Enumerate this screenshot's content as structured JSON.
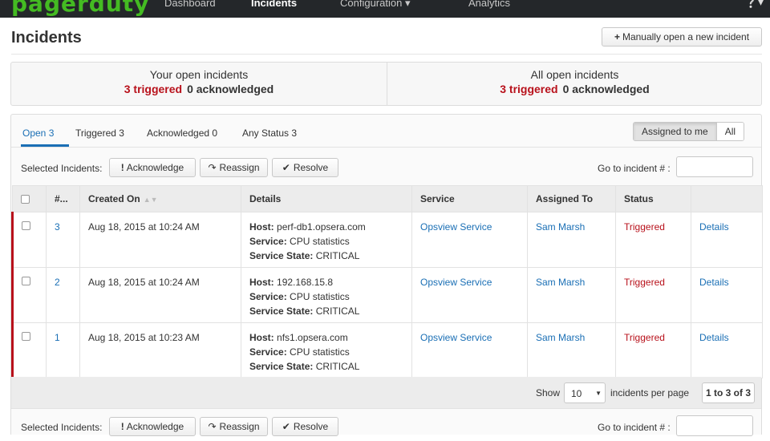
{
  "nav": {
    "logo": "pagerduty",
    "items": [
      {
        "label": "Dashboard",
        "active": false
      },
      {
        "label": "Incidents",
        "active": true
      },
      {
        "label": "Configuration ▾",
        "active": false
      },
      {
        "label": "Analytics",
        "active": false
      }
    ],
    "help_icon": "question-circle-icon"
  },
  "header": {
    "title": "Incidents",
    "new_incident_label": "Manually open a new incident"
  },
  "summary": {
    "yours": {
      "label": "Your open incidents",
      "triggered": "3 triggered",
      "acknowledged": "0 acknowledged"
    },
    "all": {
      "label": "All open incidents",
      "triggered": "3 triggered",
      "acknowledged": "0 acknowledged"
    }
  },
  "tabs": [
    {
      "label": "Open 3",
      "active": true
    },
    {
      "label": "Triggered 3",
      "active": false
    },
    {
      "label": "Acknowledged 0",
      "active": false
    },
    {
      "label": "Any Status 3",
      "active": false
    }
  ],
  "assignment_toggle": {
    "assigned_to_me": "Assigned to me",
    "all": "All"
  },
  "actions": {
    "selected_label": "Selected Incidents:",
    "acknowledge": "Acknowledge",
    "reassign": "Reassign",
    "resolve": "Resolve",
    "goto_label": "Go to incident # :"
  },
  "table": {
    "headers": [
      "#...",
      "Created On",
      "Details",
      "Service",
      "Assigned To",
      "Status"
    ],
    "detail_labels": {
      "host": "Host:",
      "service": "Service:",
      "state": "Service State:"
    },
    "rows": [
      {
        "num": "3",
        "created": "Aug 18, 2015 at 10:24 AM",
        "host": "perf-db1.opsera.com",
        "service_detail": "CPU statistics",
        "state": "CRITICAL",
        "service": "Opsview Service",
        "assigned": "Sam Marsh",
        "status": "Triggered",
        "link": "Details"
      },
      {
        "num": "2",
        "created": "Aug 18, 2015 at 10:24 AM",
        "host": "192.168.15.8",
        "service_detail": "CPU statistics",
        "state": "CRITICAL",
        "service": "Opsview Service",
        "assigned": "Sam Marsh",
        "status": "Triggered",
        "link": "Details"
      },
      {
        "num": "1",
        "created": "Aug 18, 2015 at 10:23 AM",
        "host": "nfs1.opsera.com",
        "service_detail": "CPU statistics",
        "state": "CRITICAL",
        "service": "Opsview Service",
        "assigned": "Sam Marsh",
        "status": "Triggered",
        "link": "Details"
      }
    ]
  },
  "pagination": {
    "show_label": "Show",
    "per_page_value": "10",
    "per_page_label": "incidents per page",
    "range": "1 to 3 of 3"
  },
  "colors": {
    "triggered": "#b8111b",
    "link": "#1a6fb5",
    "brand": "#44bb22"
  }
}
